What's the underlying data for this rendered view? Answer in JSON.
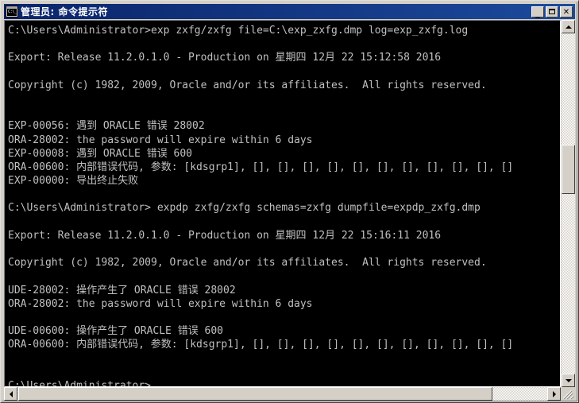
{
  "window": {
    "title": "管理员:  命令提示符",
    "icon_name": "cmd-icon",
    "icon_text": "C:\\_",
    "controls": {
      "minimize": "_",
      "maximize": "",
      "close": "✕"
    },
    "colors": {
      "titlebar_start": "#0a246a",
      "titlebar_end": "#1c4a9c",
      "frame": "#d4d0c8",
      "console_bg": "#000000",
      "console_fg": "#c0c0c0"
    }
  },
  "console": {
    "lines": [
      "C:\\Users\\Administrator>exp zxfg/zxfg file=C:\\exp_zxfg.dmp log=exp_zxfg.log",
      "",
      "Export: Release 11.2.0.1.0 - Production on 星期四 12月 22 15:12:58 2016",
      "",
      "Copyright (c) 1982, 2009, Oracle and/or its affiliates.  All rights reserved.",
      "",
      "",
      "EXP-00056: 遇到 ORACLE 错误 28002",
      "ORA-28002: the password will expire within 6 days",
      "EXP-00008: 遇到 ORACLE 错误 600",
      "ORA-00600: 内部错误代码, 参数: [kdsgrp1], [], [], [], [], [], [], [], [], [], [], []",
      "EXP-00000: 导出终止失败",
      "",
      "C:\\Users\\Administrator> expdp zxfg/zxfg schemas=zxfg dumpfile=expdp_zxfg.dmp",
      "",
      "Export: Release 11.2.0.1.0 - Production on 星期四 12月 22 15:16:11 2016",
      "",
      "Copyright (c) 1982, 2009, Oracle and/or its affiliates.  All rights reserved.",
      "",
      "UDE-28002: 操作产生了 ORACLE 错误 28002",
      "ORA-28002: the password will expire within 6 days",
      "",
      "UDE-00600: 操作产生了 ORACLE 错误 600",
      "ORA-00600: 内部错误代码, 参数: [kdsgrp1], [], [], [], [], [], [], [], [], [], [], []",
      "",
      "",
      "C:\\Users\\Administrator>"
    ],
    "prompt_cursor": "▃"
  },
  "scrollbars": {
    "vertical": {
      "up_arrow": "▲",
      "down_arrow": "▼"
    },
    "horizontal": {
      "left_arrow": "◀",
      "right_arrow": "▶"
    }
  }
}
